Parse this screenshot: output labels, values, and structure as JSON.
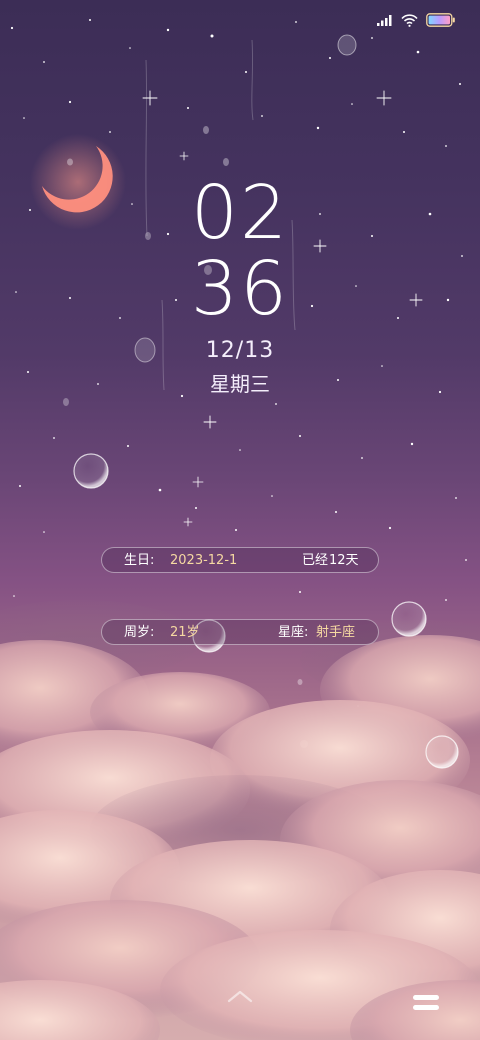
{
  "status_bar": {
    "signal_icon": "cellular-signal-icon",
    "wifi_icon": "wifi-icon",
    "battery_icon": "battery-icon",
    "battery_colors": [
      "#7fd6ff",
      "#b99cff",
      "#ff9ec7"
    ]
  },
  "clock": {
    "hours": "02",
    "minutes": "36",
    "date": "12/13",
    "weekday": "星期三"
  },
  "birthday_pill": {
    "label": "生日:",
    "value": "2023-12-1",
    "elapsed_prefix": "已经",
    "elapsed_value": "12天"
  },
  "age_pill": {
    "age_label": "周岁:",
    "age_value": "21岁",
    "zodiac_label": "星座:",
    "zodiac_value": "射手座"
  },
  "controls": {
    "swipe_up_icon": "chevron-up-icon",
    "menu_icon": "menu-icon"
  },
  "colors": {
    "accent_value": "#f6d9a2",
    "moon": "#ff8a7a"
  }
}
